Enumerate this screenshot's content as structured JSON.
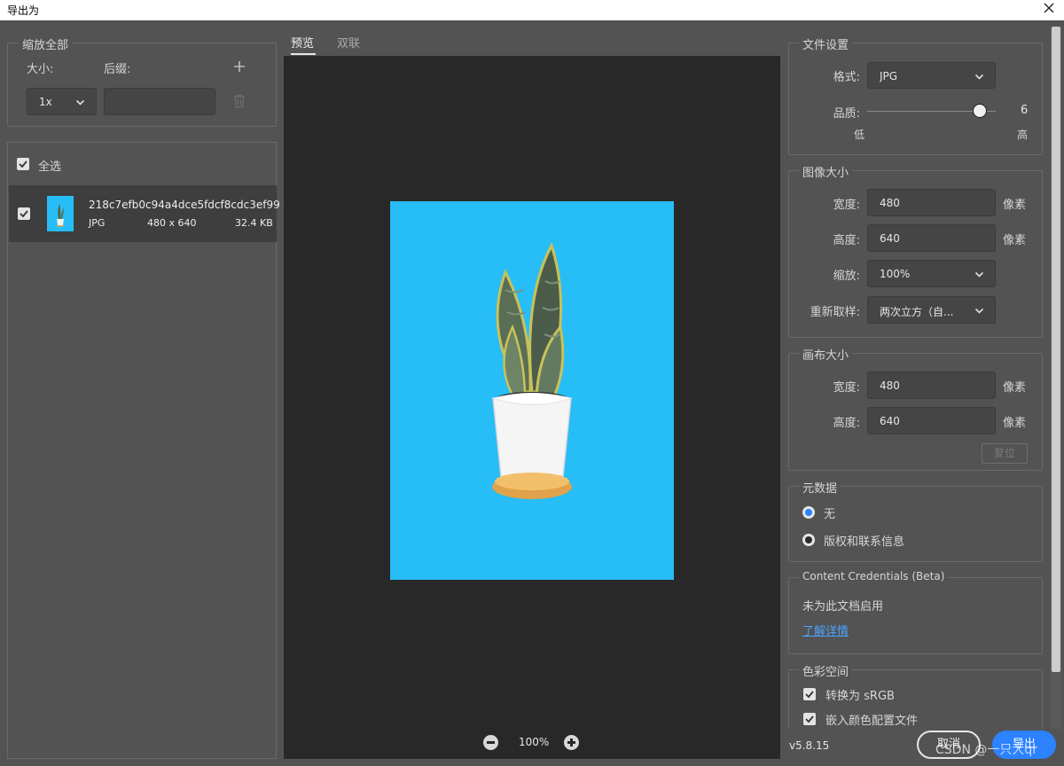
{
  "window": {
    "title": "导出为"
  },
  "left": {
    "scale_all": {
      "legend": "缩放全部",
      "size_label": "大小:",
      "suffix_label": "后缀:",
      "size_value": "1x",
      "suffix_value": ""
    },
    "select_all_label": "全选",
    "file": {
      "name": "218c7efb0c94a4dce5fdcf8cdc3ef99",
      "format": "JPG",
      "dimensions": "480 x 640",
      "size": "32.4 KB"
    }
  },
  "preview": {
    "tabs": [
      {
        "label": "预览"
      },
      {
        "label": "双联"
      }
    ],
    "zoom": "100%"
  },
  "right": {
    "file_settings": {
      "legend": "文件设置",
      "format_label": "格式:",
      "format_value": "JPG",
      "quality_label": "品质:",
      "quality_value": "6",
      "quality_fraction": 0.875,
      "low_label": "低",
      "high_label": "高"
    },
    "image_size": {
      "legend": "图像大小",
      "width_label": "宽度:",
      "width_value": "480",
      "height_label": "高度:",
      "height_value": "640",
      "scale_label": "缩放:",
      "scale_value": "100%",
      "resample_label": "重新取样:",
      "resample_value": "两次立方（自...",
      "unit": "像素"
    },
    "canvas_size": {
      "legend": "画布大小",
      "width_label": "宽度:",
      "width_value": "480",
      "height_label": "高度:",
      "height_value": "640",
      "unit": "像素",
      "reset_label": "复位"
    },
    "metadata": {
      "legend": "元数据",
      "option_none": "无",
      "option_copyright": "版权和联系信息"
    },
    "credentials": {
      "legend": "Content Credentials (Beta)",
      "status": "未为此文档启用",
      "link": "了解详情"
    },
    "color_space": {
      "legend": "色彩空间",
      "convert_srgb": "转换为 sRGB",
      "embed_profile": "嵌入颜色配置文件"
    }
  },
  "footer": {
    "version": "v5.8.15",
    "cancel_label": "取消",
    "export_label": "导出",
    "watermark": "CSDN @一只大qr"
  },
  "colors": {
    "panel_bg": "#535353",
    "preview_bg": "#282828",
    "artboard": "#27bdf7",
    "accent": "#2c82ff"
  }
}
